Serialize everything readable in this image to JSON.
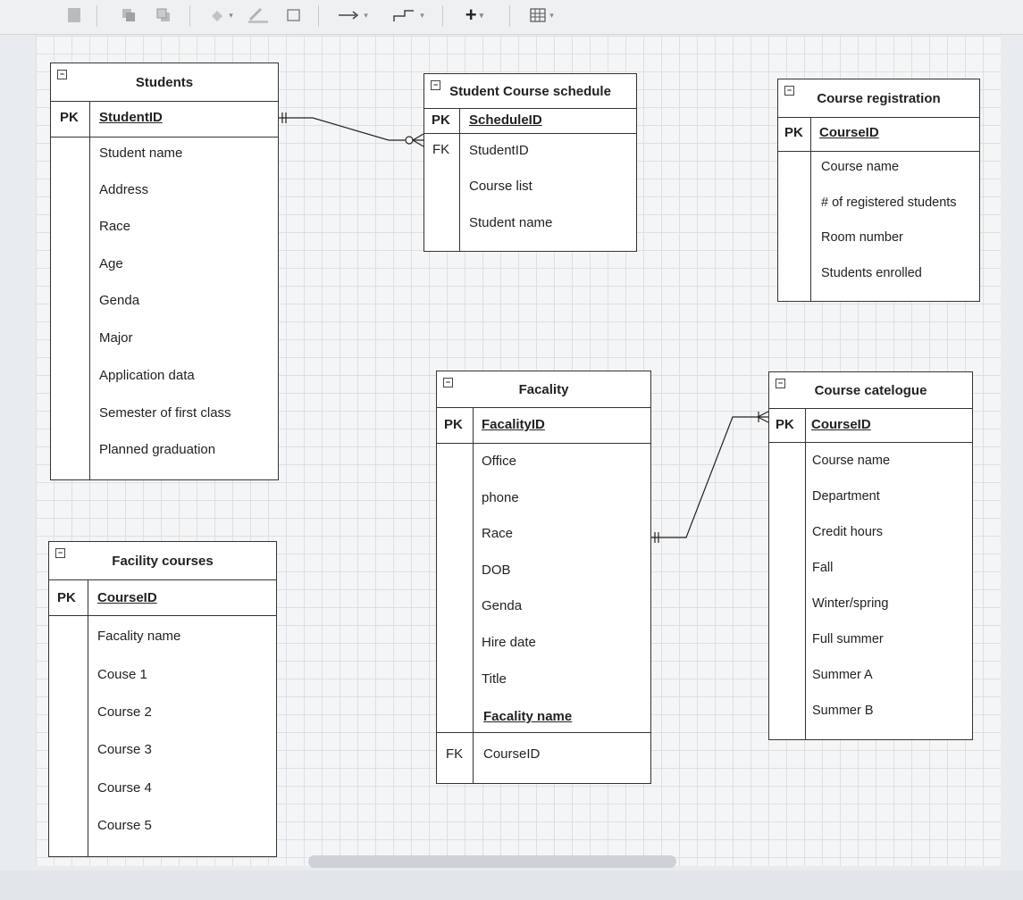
{
  "toolbar": {
    "icons": [
      "delete-icon",
      "to-front-icon",
      "to-back-icon",
      "fill-color-icon",
      "line-color-icon",
      "shadow-icon",
      "connection-arrow-icon",
      "waypoints-icon",
      "insert-plus-icon",
      "table-icon"
    ]
  },
  "entities": {
    "students": {
      "title": "Students",
      "pk_label": "PK",
      "pk_field": "StudentID",
      "fields": [
        "Student name",
        "Address",
        "Race",
        "Age",
        "Genda",
        "Major",
        "Application data",
        "Semester of first class",
        "Planned graduation"
      ]
    },
    "schedule": {
      "title": "Student Course schedule",
      "pk_label": "PK",
      "pk_field": "ScheduleID",
      "fk_label": "FK",
      "fields": [
        "StudentID",
        "Course list",
        "Student name"
      ]
    },
    "registration": {
      "title": "Course registration",
      "pk_label": "PK",
      "pk_field": "CourseID",
      "fields": [
        "Course name",
        "# of registered students",
        "Room number",
        "Students enrolled"
      ]
    },
    "facality": {
      "title": "Facality",
      "pk_label": "PK",
      "pk_field": "FacalityID",
      "fields": [
        "Office",
        "phone",
        "Race",
        "DOB",
        "Genda",
        "Hire date",
        "Title"
      ],
      "underlined_field": "Facality name",
      "fk_label": "FK",
      "fk_field": "CourseID"
    },
    "catalogue": {
      "title": "Course catelogue",
      "pk_label": "PK",
      "pk_field": "CourseID",
      "fields": [
        "Course name",
        "Department",
        "Credit hours",
        "Fall",
        "Winter/spring",
        "Full summer",
        "Summer A",
        "Summer B"
      ]
    },
    "facility_courses": {
      "title": "Facility courses",
      "pk_label": "PK",
      "pk_field": "CourseID",
      "fields": [
        "Facality name",
        "Couse 1",
        "Course 2",
        "Course 3",
        "Course 4",
        "Course 5"
      ]
    }
  }
}
